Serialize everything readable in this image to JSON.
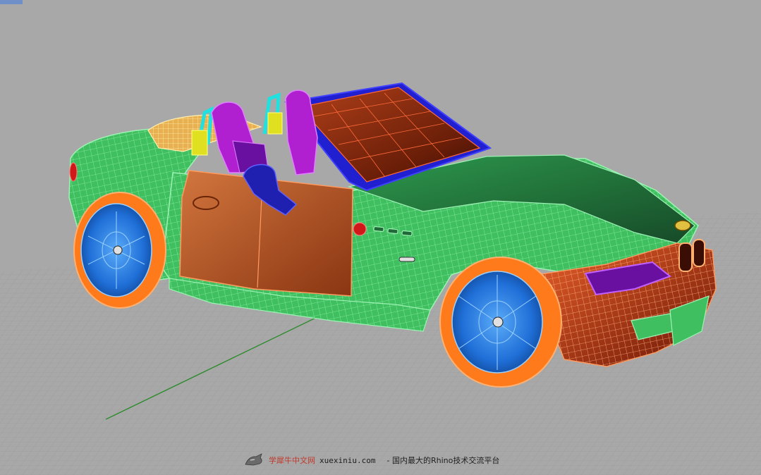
{
  "app": {
    "name": "Rhino"
  },
  "viewport": {
    "view": "Perspective",
    "display_mode": "Rendered wireframe",
    "background_color": "#a8a8a8",
    "grid_color": "#9a9a9a",
    "axis_color": "#2e8b2e",
    "grid": true
  },
  "model": {
    "subject": "roadster car",
    "layer_colors": {
      "body": "#3fbf5f",
      "doors": "#c05a2a",
      "front_bumper": "#d9481c",
      "tires": "#ff7a1a",
      "rims": "#2a7fe0",
      "seats": "#b020d0",
      "windshield_frame": "#2020d0",
      "windshield_glass": "#8a2a10",
      "roll_bars": "#20e0e0",
      "headlights": "#9020e0",
      "trunk_cover": "#e8b050"
    }
  },
  "watermark": {
    "brand": "学犀牛中文网",
    "site": "xuexiniu.com",
    "tagline": "- 国内最大的Rhino技术交流平台"
  }
}
